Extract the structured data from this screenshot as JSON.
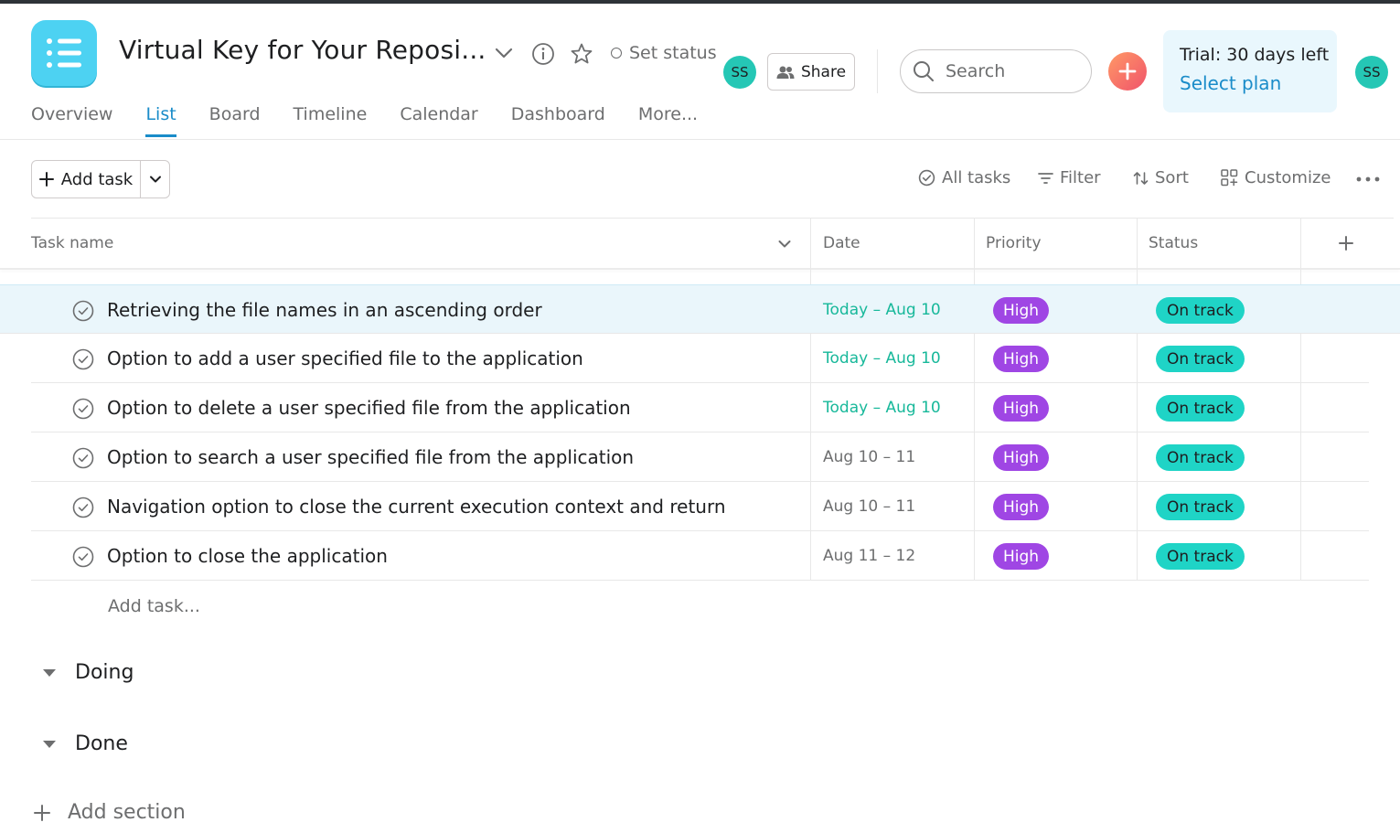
{
  "header": {
    "project_title": "Virtual Key for Your Reposi...",
    "set_status": "Set status",
    "member_avatar": "SS",
    "share_label": "Share",
    "search_placeholder": "Search",
    "trial_text": "Trial: 30 days left",
    "select_plan": "Select plan",
    "user_avatar": "SS"
  },
  "tabs": [
    {
      "label": "Overview",
      "active": false
    },
    {
      "label": "List",
      "active": true
    },
    {
      "label": "Board",
      "active": false
    },
    {
      "label": "Timeline",
      "active": false
    },
    {
      "label": "Calendar",
      "active": false
    },
    {
      "label": "Dashboard",
      "active": false
    },
    {
      "label": "More...",
      "active": false
    }
  ],
  "toolbar": {
    "add_task": "Add task",
    "all_tasks": "All tasks",
    "filter": "Filter",
    "sort": "Sort",
    "customize": "Customize"
  },
  "columns": {
    "task_name": "Task name",
    "date": "Date",
    "priority": "Priority",
    "status": "Status"
  },
  "tasks": [
    {
      "name": "Retrieving the file names in an ascending order",
      "date": "Today – Aug 10",
      "priority": "High",
      "status": "On track"
    },
    {
      "name": "Option to add a user specified file to the application",
      "date": "Today – Aug 10",
      "priority": "High",
      "status": "On track"
    },
    {
      "name": "Option to delete a user specified file from the application",
      "date": "Today – Aug 10",
      "priority": "High",
      "status": "On track"
    },
    {
      "name": "Option to search a user specified file from the application",
      "date": "Aug 10 – 11",
      "priority": "High",
      "status": "On track"
    },
    {
      "name": "Navigation option to close the current execution context and return",
      "date": "Aug 10 – 11",
      "priority": "High",
      "status": "On track"
    },
    {
      "name": "Option to close the application",
      "date": "Aug 11 – 12",
      "priority": "High",
      "status": "On track"
    }
  ],
  "add_task_inline": "Add task...",
  "sections": [
    {
      "label": "Doing"
    },
    {
      "label": "Done"
    }
  ],
  "add_section": "Add section",
  "colors": {
    "accent": "#1a8cc9",
    "priority_high": "#9f46e4",
    "status_on_track": "#1fd4c6",
    "date_today": "#17b89a",
    "project_icon": "#4dd2f2"
  }
}
